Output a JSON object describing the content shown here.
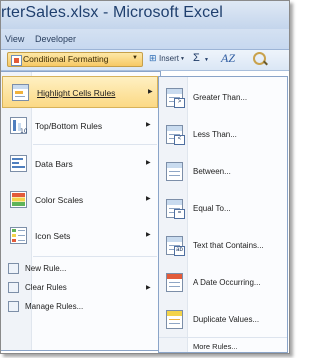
{
  "window": {
    "title": "rterSales.xlsx - Microsoft Excel"
  },
  "ribbon": {
    "tabs": [
      "View",
      "Developer"
    ],
    "conditional_formatting_label": "Conditional Formatting",
    "insert_label": "Insert",
    "sum_label": "Σ",
    "sort_label": "AZ"
  },
  "cf_menu": {
    "items": [
      {
        "label": "Highlight Cells Rules",
        "has_submenu": true,
        "highlighted": true,
        "icon": "highlight-cells-icon"
      },
      {
        "label": "Top/Bottom Rules",
        "has_submenu": true,
        "icon": "top-bottom-icon"
      },
      {
        "label": "Data Bars",
        "has_submenu": true,
        "icon": "data-bars-icon"
      },
      {
        "label": "Color Scales",
        "has_submenu": true,
        "icon": "color-scales-icon"
      },
      {
        "label": "Icon Sets",
        "has_submenu": true,
        "icon": "icon-sets-icon"
      }
    ],
    "actions": [
      {
        "label": "New Rule...",
        "has_submenu": false,
        "icon": "new-rule-icon"
      },
      {
        "label": "Clear Rules",
        "has_submenu": true,
        "icon": "clear-rules-icon"
      },
      {
        "label": "Manage Rules...",
        "has_submenu": false,
        "icon": "manage-rules-icon"
      }
    ]
  },
  "highlight_submenu": {
    "items": [
      {
        "label": "Greater Than...",
        "badge": ">"
      },
      {
        "label": "Less Than...",
        "badge": "<"
      },
      {
        "label": "Between...",
        "badge": ""
      },
      {
        "label": "Equal To...",
        "badge": "="
      },
      {
        "label": "Text that Contains...",
        "badge": "ab"
      },
      {
        "label": "A Date Occurring...",
        "badge": ""
      },
      {
        "label": "Duplicate Values...",
        "badge": ""
      }
    ],
    "more_rules": "More Rules..."
  }
}
